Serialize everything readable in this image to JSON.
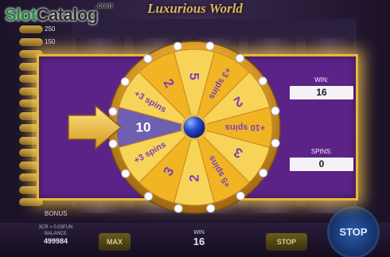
{
  "brand": {
    "logo_slot": "Slot",
    "logo_catalog": "Catalog",
    "logo_domain": ".com"
  },
  "game": {
    "title": "Luxurious World"
  },
  "paytable": {
    "values": [
      "250",
      "150",
      "",
      "",
      "",
      "",
      "",
      "",
      "",
      "",
      "",
      "",
      "",
      "",
      ""
    ],
    "bonus_label": "BONUS"
  },
  "bottom_bar": {
    "bet_label": "3CR = 0.03FUN",
    "balance_label": "BALANCE",
    "balance_value": "499984",
    "max_label": "MAX",
    "win_label": "WIN",
    "win_value": "16",
    "stop_label": "STOP",
    "stop_button_label": "STOP"
  },
  "bonus_wheel": {
    "segments": [
      "10",
      "+3 spins",
      "2",
      "5",
      "+3 spins",
      "2",
      "+10 spins",
      "3",
      "+5 spins",
      "2",
      "3",
      "+3 spins"
    ],
    "selected": "10",
    "segment_colors": {
      "selected": "#6e5fb0",
      "light": "#f7d457",
      "dark": "#f0b425"
    },
    "text_color": "#7d3fb8"
  },
  "stats": {
    "win_label": "WIN:",
    "win_value": "16",
    "spins_label": "SPINS:",
    "spins_value": "0"
  },
  "colors": {
    "panel_purple": "#5b2387",
    "frame_gold": "#e7b73b",
    "pointer_gold": "#f2c644"
  }
}
